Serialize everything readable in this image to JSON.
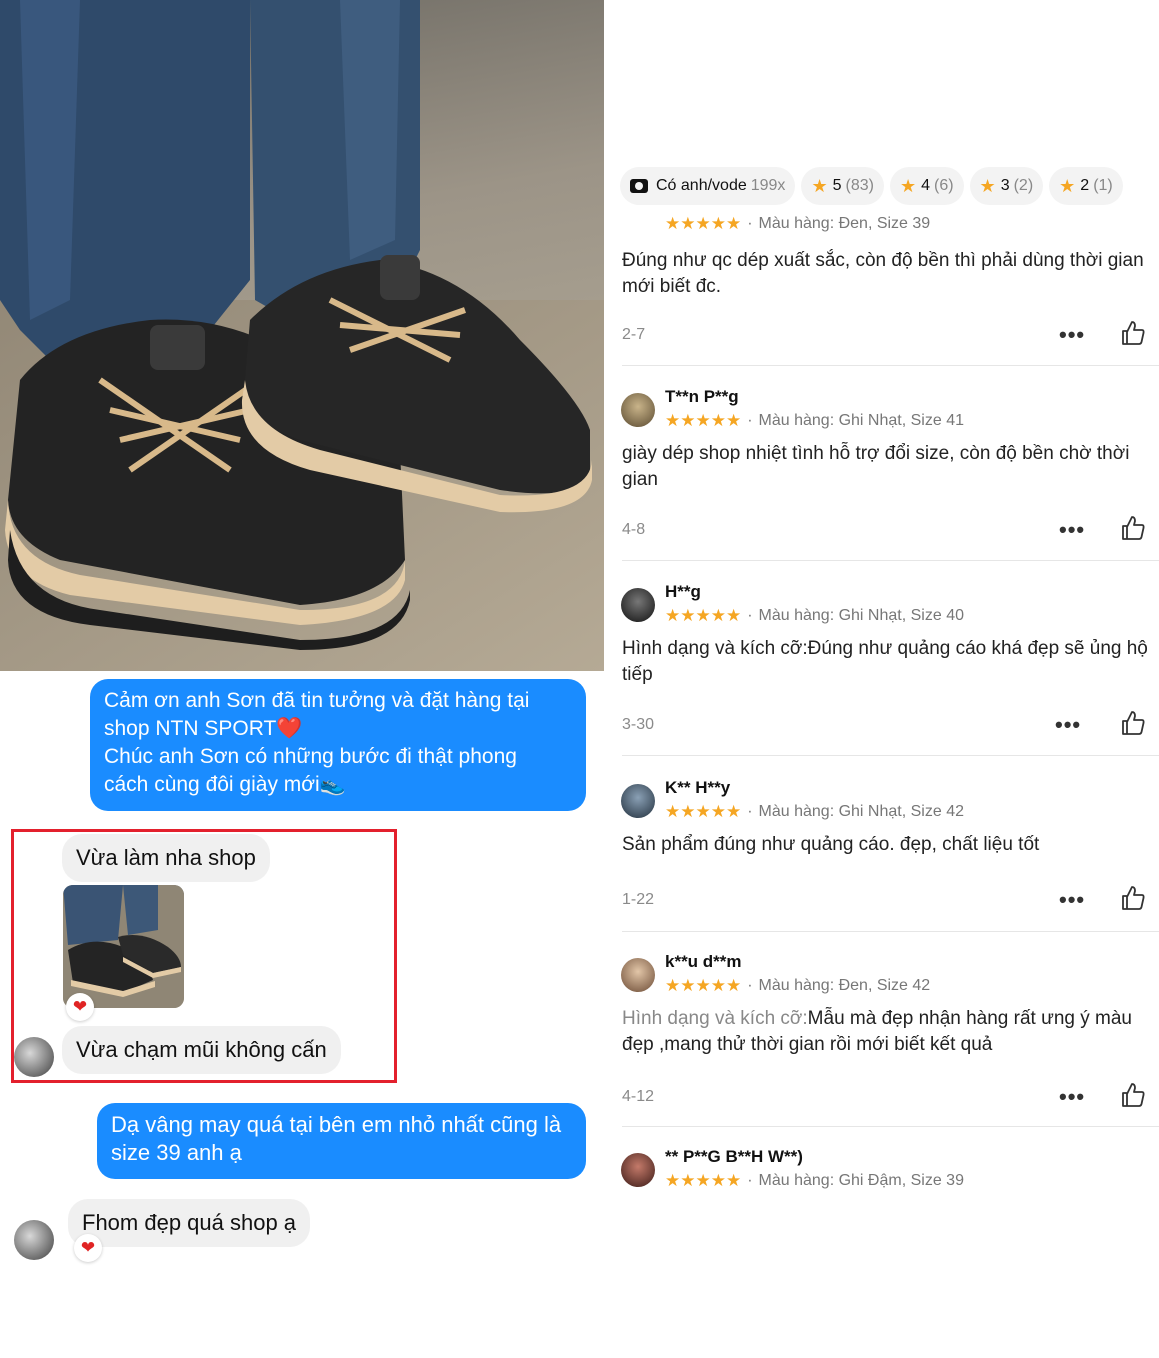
{
  "photo": {
    "alt": "Product photo: black sneakers with beige sole worn with jeans"
  },
  "chat": {
    "messages": [
      {
        "from": "shop",
        "lines": [
          "Cảm ơn anh Sơn đã tin tưởng và đặt hàng tại",
          "shop NTN SPORT❤️",
          "Chúc anh Sơn có những bước đi thật phong",
          "cách cùng đôi giày mới👟"
        ]
      },
      {
        "from": "customer",
        "text": "Vừa làm nha shop"
      },
      {
        "from": "customer",
        "text": "Vừa chạm mũi không cấn"
      },
      {
        "from": "shop",
        "lines": [
          "Dạ vâng may quá tại bên em nhỏ nhất cũng là",
          "size 39 anh ạ"
        ]
      },
      {
        "from": "customer",
        "text": "Fhom đẹp quá shop ạ"
      }
    ],
    "reaction": "❤"
  },
  "filters": [
    {
      "label": "Có anh/vode",
      "count": "199x",
      "icon": "camera-icon"
    },
    {
      "label": "5",
      "count": "(83)",
      "icon": "star-icon"
    },
    {
      "label": "4",
      "count": "(6)",
      "icon": "star-icon"
    },
    {
      "label": "3",
      "count": "(2)",
      "icon": "star-icon"
    },
    {
      "label": "2",
      "count": "(1)",
      "icon": "star-icon"
    }
  ],
  "reviews": [
    {
      "name": "",
      "stars": "★★★★★",
      "variant": "Màu hàng: Đen, Size 39",
      "text": "Đúng như qc dép xuất sắc, còn độ bền thì phải dùng thời gian mới biết đc.",
      "date": "2-7"
    },
    {
      "name": "T**n P**g",
      "stars": "★★★★★",
      "variant": "Màu hàng: Ghi Nhạt, Size 41",
      "text": "giày dép shop nhiệt tình hỗ trợ đổi size, còn độ bền chờ thời gian",
      "date": "4-8"
    },
    {
      "name": "H**g",
      "stars": "★★★★★",
      "variant": "Màu hàng: Ghi Nhạt, Size 40",
      "text": "Hình dạng và kích cỡ:Đúng như quảng cáo khá đẹp sẽ ủng hộ tiếp",
      "date": "3-30"
    },
    {
      "name": "K** H**y",
      "stars": "★★★★★",
      "variant": "Màu hàng: Ghi Nhạt, Size 42",
      "text": "Sản phẩm đúng như quảng cáo. đẹp, chất liệu tốt",
      "date": "1-22"
    },
    {
      "name": "k**u d**m",
      "stars": "★★★★★",
      "variant": "Màu hàng: Đen, Size 42",
      "text_prefix": "Hình dạng và kích cỡ:",
      "text": "Mẫu mà đẹp nhận hàng rất ưng ý màu đẹp ,mang thử thời gian rồi mới biết kết quả",
      "date": "4-12"
    },
    {
      "name": "** P**G B**H W**)",
      "stars": "★★★★★",
      "variant": "Màu hàng: Ghi Đậm, Size 39",
      "text": "",
      "date": ""
    }
  ],
  "ui": {
    "more": "•••",
    "separator": "·"
  },
  "colors": {
    "shop_bubble": "#1a8cff",
    "highlight": "#e3202d",
    "star": "#f5a623"
  }
}
